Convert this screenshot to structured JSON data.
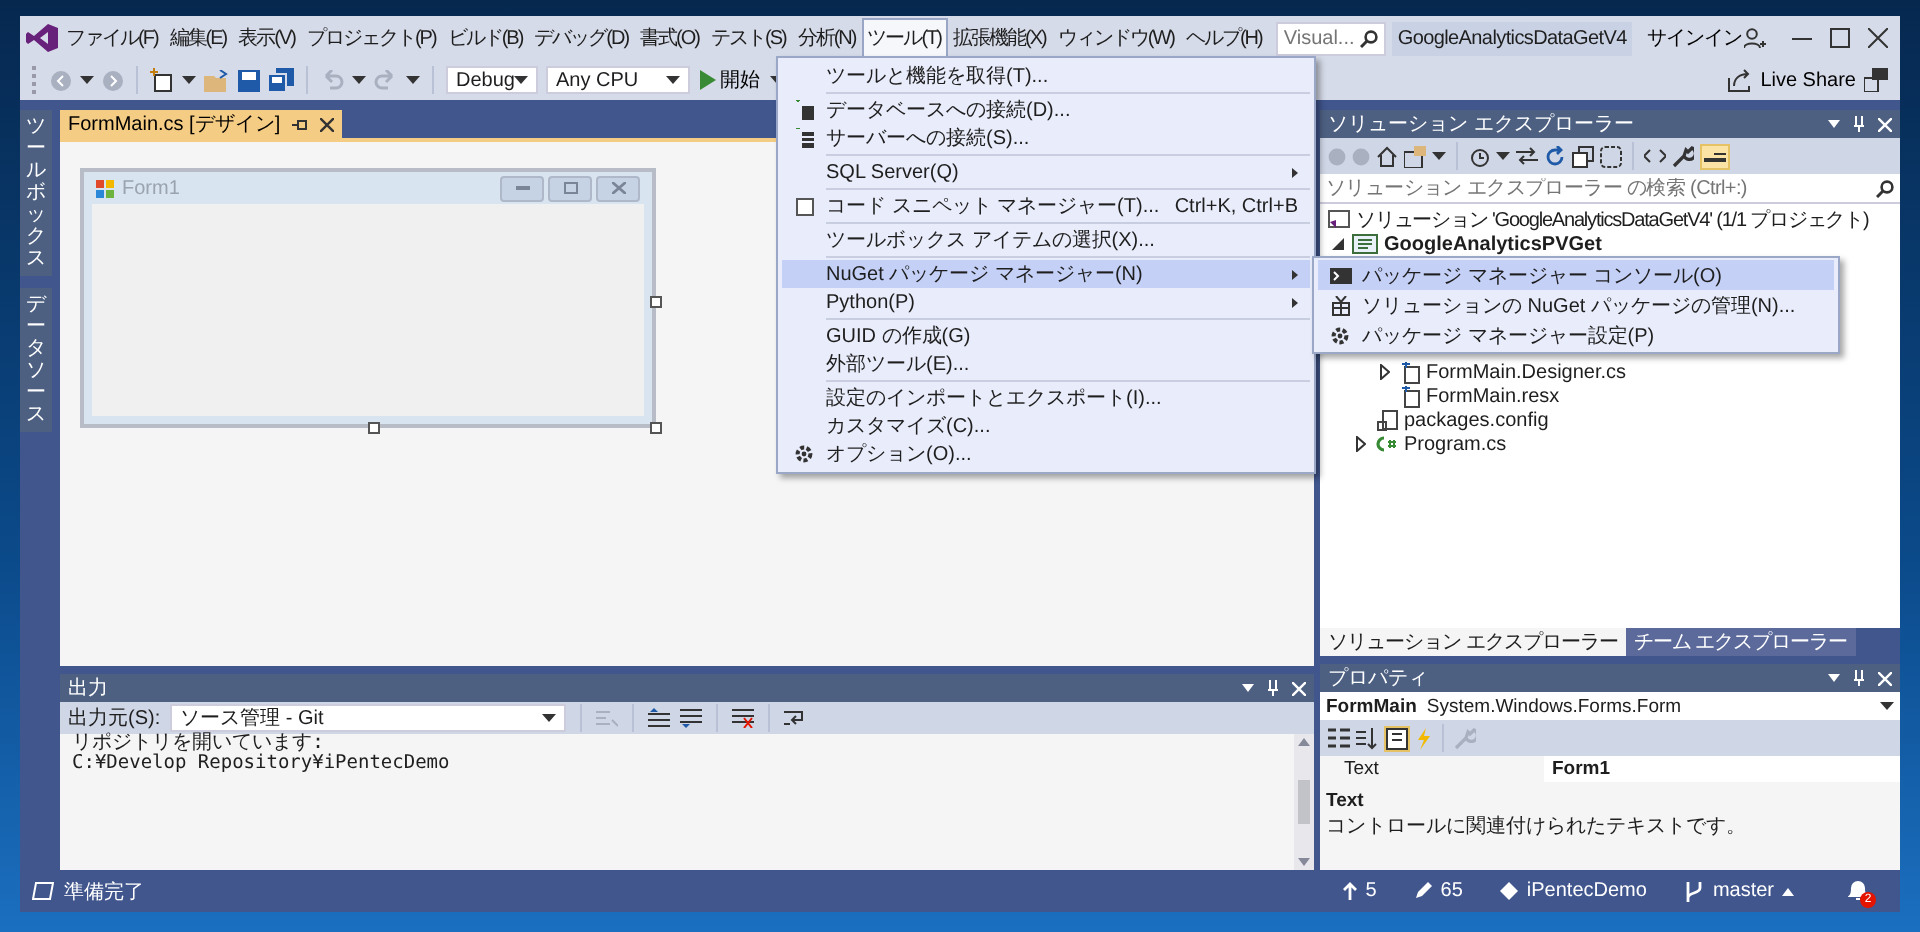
{
  "window": {
    "title": "GoogleAnalyticsDataGetV4"
  },
  "menu_bar": [
    {
      "label": "ファイル(F)",
      "selected": false
    },
    {
      "label": "編集(E)",
      "selected": false
    },
    {
      "label": "表示(V)",
      "selected": false
    },
    {
      "label": "プロジェクト(P)",
      "selected": false
    },
    {
      "label": "ビルド(B)",
      "selected": false
    },
    {
      "label": "デバッグ(D)",
      "selected": false
    },
    {
      "label": "書式(O)",
      "selected": false
    },
    {
      "label": "テスト(S)",
      "selected": false
    },
    {
      "label": "分析(N)",
      "selected": false
    },
    {
      "label": "ツール(T)",
      "selected": true
    },
    {
      "label": "拡張機能(X)",
      "selected": false
    },
    {
      "label": "ウィンドウ(W)",
      "selected": false
    },
    {
      "label": "ヘルプ(H)",
      "selected": false
    }
  ],
  "search": {
    "placeholder": "Visual..."
  },
  "account": {
    "label": "サインイン"
  },
  "toolbar": {
    "configuration": "Debug",
    "platform": "Any CPU",
    "start": "開始",
    "live_share": "Live Share"
  },
  "side_tabs": [
    "ツールボックス",
    "データソース"
  ],
  "document_tabs": [
    {
      "label": "FormMain.cs [デザイン]",
      "selected": true
    }
  ],
  "designer": {
    "form_title": "Form1"
  },
  "tools_menu": [
    {
      "kind": "item",
      "label": "ツールと機能を取得(T)...",
      "selected": false
    },
    {
      "kind": "separator"
    },
    {
      "kind": "item",
      "label": "データベースへの接続(D)...",
      "selected": false
    },
    {
      "kind": "item",
      "label": "サーバーへの接続(S)...",
      "selected": false
    },
    {
      "kind": "separator"
    },
    {
      "kind": "submenu",
      "label": "SQL Server(Q)",
      "selected": false
    },
    {
      "kind": "separator"
    },
    {
      "kind": "item",
      "label": "コード スニペット マネージャー(T)...",
      "shortcut": "Ctrl+K, Ctrl+B",
      "selected": false
    },
    {
      "kind": "separator"
    },
    {
      "kind": "item",
      "label": "ツールボックス アイテムの選択(X)...",
      "selected": false
    },
    {
      "kind": "separator"
    },
    {
      "kind": "submenu",
      "label": "NuGet パッケージ マネージャー(N)",
      "selected": true
    },
    {
      "kind": "submenu",
      "label": "Python(P)",
      "selected": false
    },
    {
      "kind": "separator"
    },
    {
      "kind": "item",
      "label": "GUID の作成(G)",
      "selected": false
    },
    {
      "kind": "item",
      "label": "外部ツール(E)...",
      "selected": false
    },
    {
      "kind": "separator"
    },
    {
      "kind": "item",
      "label": "設定のインポートとエクスポート(I)...",
      "selected": false
    },
    {
      "kind": "item",
      "label": "カスタマイズ(C)...",
      "selected": false
    },
    {
      "kind": "item",
      "label": "オプション(O)...",
      "selected": false
    }
  ],
  "nuget_submenu": [
    {
      "label": "パッケージ マネージャー コンソール(O)",
      "selected": true
    },
    {
      "label": "ソリューションの NuGet パッケージの管理(N)...",
      "selected": false
    },
    {
      "label": "パッケージ マネージャー設定(P)",
      "selected": false
    }
  ],
  "solution_explorer": {
    "title": "ソリューション エクスプローラー",
    "search_placeholder": "ソリューション エクスプローラー の検索 (Ctrl+:)",
    "tree": [
      {
        "kind": "solution",
        "label": "ソリューション 'GoogleAnalyticsDataGetV4' (1/1 プロジェクト)",
        "children": [
          {
            "kind": "project",
            "label": "GoogleAnalyticsPVGet",
            "expanded": true,
            "children": [
              {
                "kind": "hidden",
                "children": [
                  {
                    "kind": "form-file",
                    "label": "FormMain.Designer.cs",
                    "expanded": false
                  },
                  {
                    "kind": "form-file",
                    "label": "FormMain.resx"
                  }
                ]
              },
              {
                "kind": "config",
                "label": "packages.config"
              },
              {
                "kind": "csharp",
                "label": "Program.cs",
                "expanded": false
              }
            ]
          }
        ]
      }
    ],
    "tabs": [
      {
        "label": "ソリューション エクスプローラー",
        "selected": true
      },
      {
        "label": "チーム エクスプローラー",
        "selected": false
      }
    ]
  },
  "output": {
    "title": "出力",
    "source_label": "出力元(S):",
    "source": "ソース管理 - Git",
    "lines": [
      "リポジトリを開いています:",
      "C:¥Develop Repository¥iPentecDemo"
    ]
  },
  "properties": {
    "title": "プロパティ",
    "object_name": "FormMain",
    "object_type": "System.Windows.Forms.Form",
    "rows": [
      {
        "name": "Text",
        "value": "Form1"
      }
    ],
    "description_title": "Text",
    "description": "コントロールに関連付けられたテキストです。"
  },
  "status_bar": {
    "message": "準備完了",
    "push": "5",
    "changes": "65",
    "repository": "iPentecDemo",
    "branch": "master",
    "notifications": "2"
  }
}
